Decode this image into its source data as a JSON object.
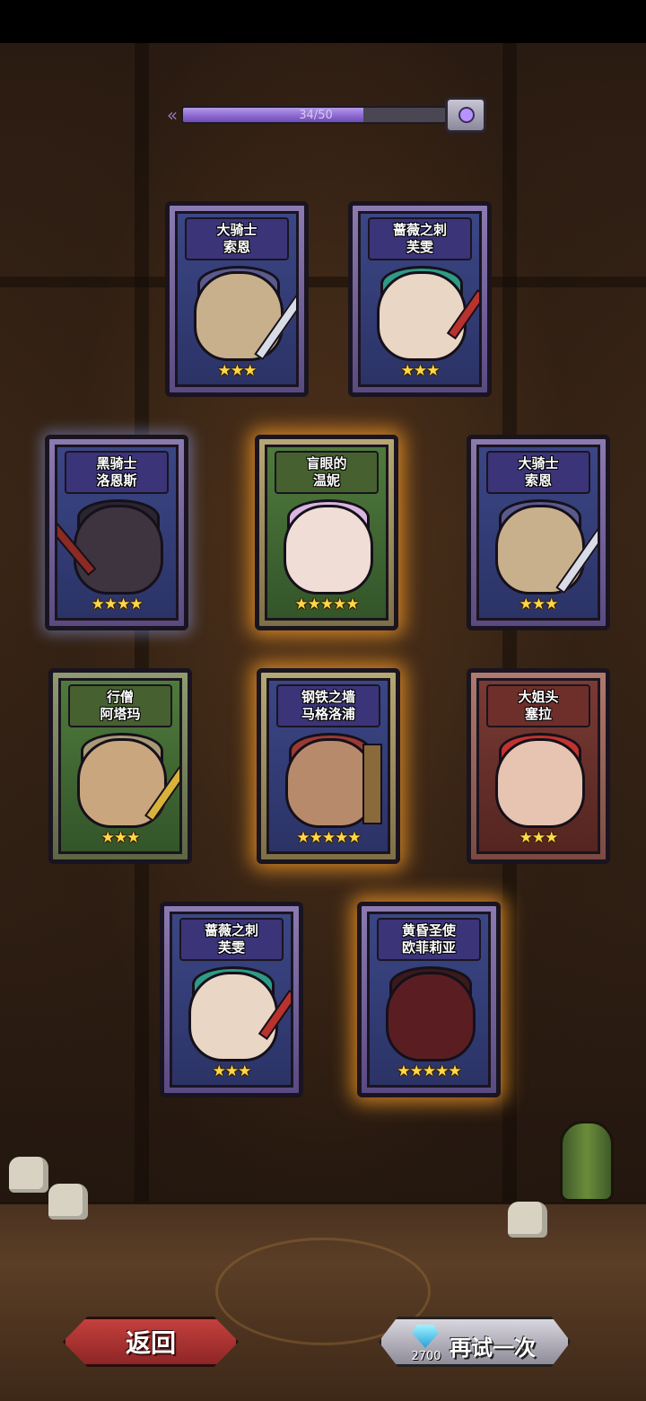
{
  "progress": {
    "text": "34/50",
    "current": 34,
    "max": 50
  },
  "cards": [
    {
      "line1": "大骑士",
      "line2": "索恩",
      "stars": "★★★"
    },
    {
      "line1": "蔷薇之刺",
      "line2": "芙雯",
      "stars": "★★★"
    },
    {
      "line1": "黑骑士",
      "line2": "洛恩斯",
      "stars": "★★★★"
    },
    {
      "line1": "盲眼的",
      "line2": "温妮",
      "stars": "★★★★★"
    },
    {
      "line1": "大骑士",
      "line2": "索恩",
      "stars": "★★★"
    },
    {
      "line1": "行僧",
      "line2": "阿塔玛",
      "stars": "★★★"
    },
    {
      "line1": "钢铁之墙",
      "line2": "马格洛浦",
      "stars": "★★★★★"
    },
    {
      "line1": "大姐头",
      "line2": "塞拉",
      "stars": "★★★"
    },
    {
      "line1": "蔷薇之刺",
      "line2": "芙雯",
      "stars": "★★★"
    },
    {
      "line1": "黄昏圣使",
      "line2": "欧菲莉亚",
      "stars": "★★★★★"
    }
  ],
  "buttons": {
    "back_label": "返回",
    "retry_label": "再试一次",
    "retry_cost": "2700",
    "retry_icon": "diamond-gem-icon"
  },
  "colors": {
    "progress_fill": "#8a66d0",
    "gold_glow": "#ffa028",
    "back_button": "#c4403d"
  }
}
